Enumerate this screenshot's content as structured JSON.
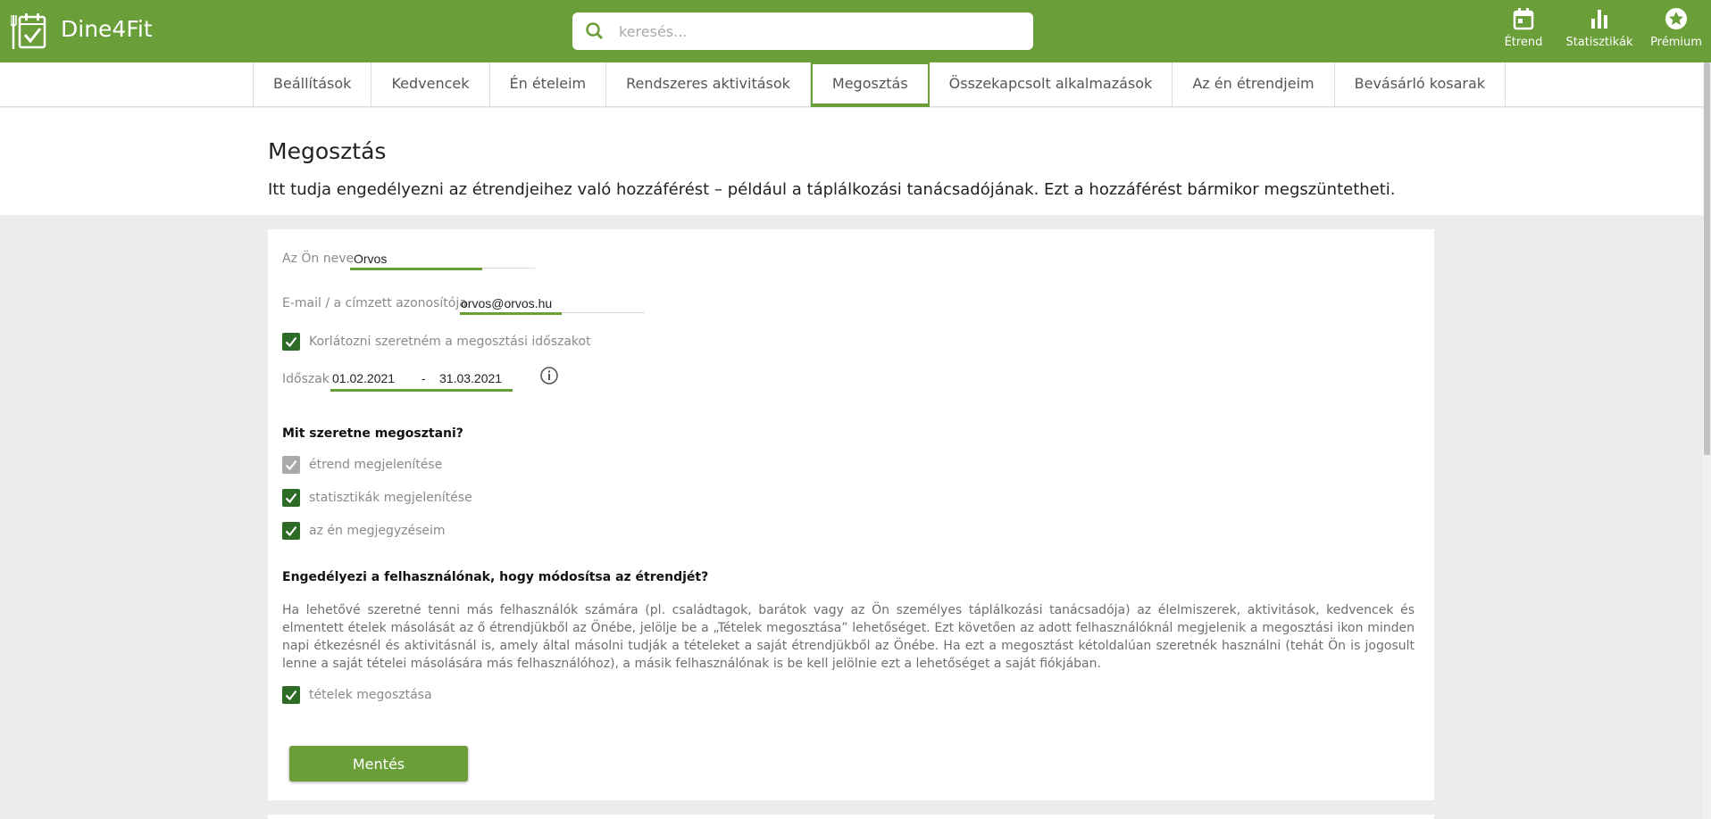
{
  "app": {
    "name": "Dine4Fit"
  },
  "search": {
    "placeholder": "keresés..."
  },
  "topnav": [
    {
      "label": "Étrend",
      "icon": "calendar-icon"
    },
    {
      "label": "Statisztikák",
      "icon": "bar-chart-icon"
    },
    {
      "label": "Prémium",
      "icon": "star-badge-icon"
    }
  ],
  "tabs": [
    {
      "label": "Beállítások",
      "active": false
    },
    {
      "label": "Kedvencek",
      "active": false
    },
    {
      "label": "Én ételeim",
      "active": false
    },
    {
      "label": "Rendszeres aktivitások",
      "active": false
    },
    {
      "label": "Megosztás",
      "active": true
    },
    {
      "label": "Összekapcsolt alkalmazások",
      "active": false
    },
    {
      "label": "Az én étrendjeim",
      "active": false
    },
    {
      "label": "Bevásárló kosarak",
      "active": false
    }
  ],
  "page": {
    "title": "Megosztás",
    "description": "Itt tudja engedélyezni az étrendjeihez való hozzáférést – például a táplálkozási tanácsadójának. Ezt a hozzáférést bármikor megszüntetheti."
  },
  "form": {
    "name_label": "Az Ön neve",
    "name_value": "Orvos",
    "email_label": "E-mail / a címzett azonosítója",
    "email_value": "orvos@orvos.hu",
    "limit_period_label": "Korlátozni szeretném a megosztási időszakot",
    "period_label": "Időszak",
    "period_from": "01.02.2021",
    "period_separator": "-",
    "period_to": "31.03.2021",
    "share_heading": "Mit szeretne megosztani?",
    "share_options": [
      {
        "label": "étrend megjelenítése",
        "checked": true,
        "disabled": true
      },
      {
        "label": "statisztikák megjelenítése",
        "checked": true,
        "disabled": false
      },
      {
        "label": "az én megjegyzéseim",
        "checked": true,
        "disabled": false
      }
    ],
    "modify_heading": "Engedélyezi a felhasználónak, hogy módosítsa az étrendjét?",
    "modify_text": "Ha lehetővé szeretné tenni más felhasználók számára (pl. családtagok, barátok vagy az Ön személyes táplálkozási tanácsadója) az élelmiszerek, aktivitások, kedvencek és elmentett ételek másolását az ő étrendjükből az Önébe, jelölje be a „Tételek megosztása” lehetőséget. Ezt követően az adott felhasználóknál megjelenik a megosztási ikon minden napi étkezésnél és aktivitásnál is, amely által másolni tudják a tételeket a saját étrendjükből az Önébe. Ha ezt a megosztást kétoldalúan szeretnék használni (tehát Ön is jogosult lenne a saját tételei másolására más felhasználóhoz), a másik felhasználónak is be kell jelölnie ezt a lehetőséget a saját fiókjában.",
    "share_items_label": "tételek megosztása",
    "save_label": "Mentés"
  },
  "colors": {
    "brand_green": "#6a9e38",
    "checkbox_green": "#2e6b26",
    "checkbox_disabled": "#a9a9a9"
  }
}
